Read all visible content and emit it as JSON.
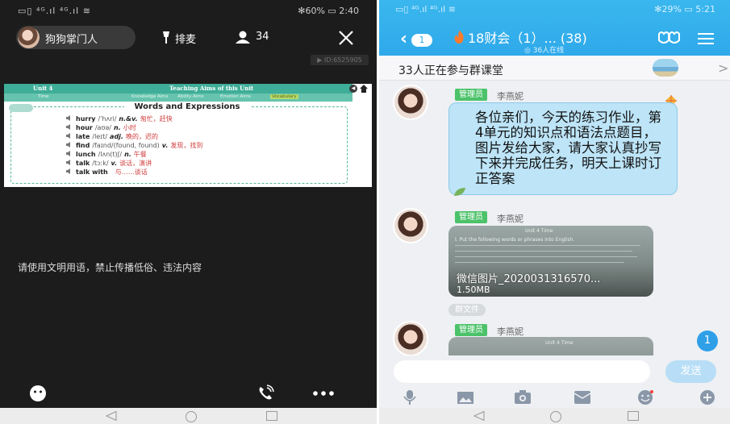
{
  "left": {
    "status": {
      "signal": "▭▯ ⁴ᴳ.ıl ⁴ᴳ.ıl ≋",
      "battery": "✻60% ▭ 2:40"
    },
    "host": {
      "name": "狗狗掌门人"
    },
    "mic": {
      "label": "排麦"
    },
    "audience": {
      "count": "34"
    },
    "room_id": "▶ ID:6525905",
    "slide": {
      "header": {
        "unit": "Unit 4",
        "title": "Teaching Aims of this Unit",
        "row2_time": "Time",
        "row2_knowledge": "Knowledge Aims",
        "row2_ability": "Ability Aims",
        "row2_emotion": "Emotion Aims",
        "row2_highlight": "Vocabulary"
      },
      "nav": {
        "back": "◀"
      },
      "box_title": "Words and Expressions",
      "words": [
        {
          "en": "hurry",
          "phonetic": "/ˈhʌri/",
          "pos": "n.&v.",
          "cn": "匆忙，赶快"
        },
        {
          "en": "hour",
          "phonetic": "/aʊə/",
          "pos": "n.",
          "cn": "小时"
        },
        {
          "en": "late",
          "phonetic": "/leɪt/",
          "pos": "adj.",
          "cn": "晚的，迟的"
        },
        {
          "en": "find",
          "phonetic": "/faɪnd/(found, found)",
          "pos": "v.",
          "cn": "发现，找到"
        },
        {
          "en": "lunch",
          "phonetic": "/lʌn(t)ʃ/",
          "pos": "n.",
          "cn": "午餐"
        },
        {
          "en": "talk",
          "phonetic": "/tɔːk/",
          "pos": "v.",
          "cn": "谈话，演讲"
        },
        {
          "en": "talk with",
          "phonetic": "",
          "pos": "",
          "cn": "与……谈话"
        }
      ]
    },
    "notice": "请使用文明用语，禁止传播低俗、违法内容"
  },
  "right": {
    "status": {
      "signal": "▭▯ ⁴ᴳ.ıl ⁴ᴳ.ıl ≋",
      "battery": "✻29% ▭ 5:21"
    },
    "back_badge": "1",
    "chat_title": "18财会（1）...  (38)",
    "chat_subtitle": "◎ 36人在线",
    "banner": {
      "text": "33人正在参与群课堂",
      "arrow": ">"
    },
    "messages": [
      {
        "role": "管理员",
        "sender": "李燕妮",
        "text": "各位亲们，今天的练习作业，第4单元的知识点和语法点题目，图片发给大家，请大家认真抄写下来并完成任务，明天上课时订正答案"
      },
      {
        "role": "管理员",
        "sender": "李燕妮",
        "file_title": "Unit 4 Time",
        "file_caption": "I. Put the following words or phrases into English.",
        "file_name": "微信图片_2020031316570...",
        "file_size": "1.50MB",
        "file_tag": "群文件"
      },
      {
        "role": "管理员",
        "sender": "李燕妮",
        "preview_title": "Unit 4 Time"
      }
    ],
    "unread_count": "1",
    "input": {
      "placeholder": ""
    },
    "send_label": "发送"
  },
  "colors": {
    "header_blue": "#2fa9ea",
    "admin_green": "#4cc26a",
    "bubble": "#bde4f7",
    "slide_green": "#3fae98"
  }
}
